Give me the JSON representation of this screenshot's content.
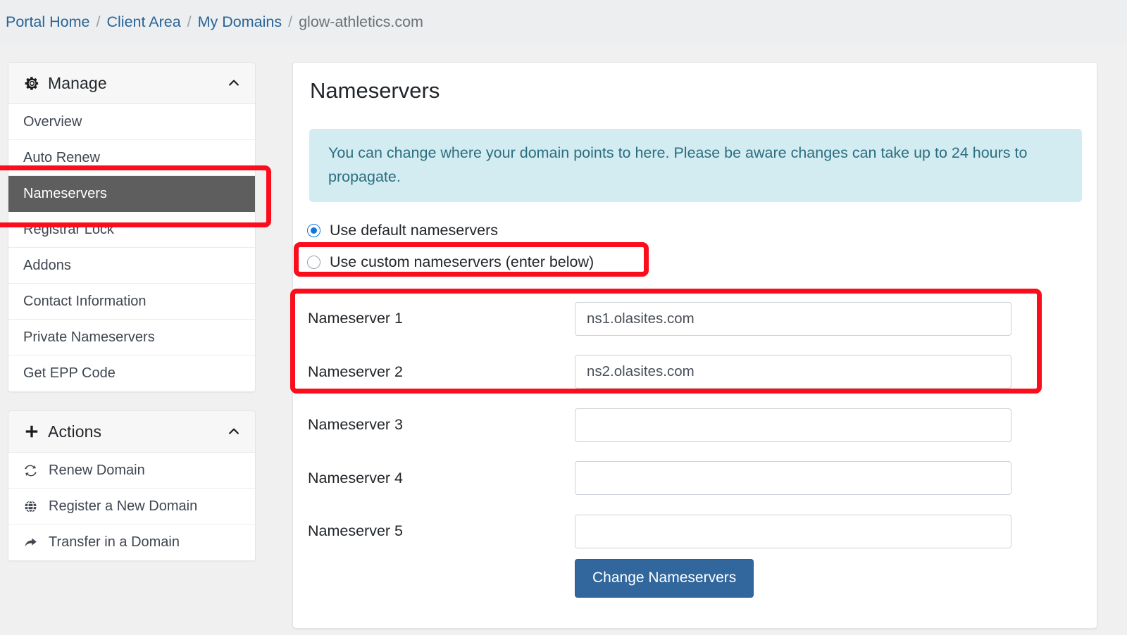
{
  "breadcrumb": {
    "items": [
      {
        "label": "Portal Home",
        "link": true
      },
      {
        "label": "Client Area",
        "link": true
      },
      {
        "label": "My Domains",
        "link": true
      },
      {
        "label": "glow-athletics.com",
        "link": false
      }
    ],
    "separator": "/"
  },
  "sidebar": {
    "manage": {
      "title": "Manage",
      "icon": "gear-icon",
      "caret": "chevron-up-icon",
      "items": [
        {
          "label": "Overview",
          "active": false
        },
        {
          "label": "Auto Renew",
          "active": false
        },
        {
          "label": "Nameservers",
          "active": true
        },
        {
          "label": "Registrar Lock",
          "active": false
        },
        {
          "label": "Addons",
          "active": false
        },
        {
          "label": "Contact Information",
          "active": false
        },
        {
          "label": "Private Nameservers",
          "active": false
        },
        {
          "label": "Get EPP Code",
          "active": false
        }
      ]
    },
    "actions": {
      "title": "Actions",
      "icon": "plus-icon",
      "caret": "chevron-up-icon",
      "items": [
        {
          "label": "Renew Domain",
          "icon": "refresh-icon"
        },
        {
          "label": "Register a New Domain",
          "icon": "globe-icon"
        },
        {
          "label": "Transfer in a Domain",
          "icon": "share-arrow-icon"
        }
      ]
    }
  },
  "main": {
    "title": "Nameservers",
    "alert": "You can change where your domain points to here. Please be aware changes can take up to 24 hours to propagate.",
    "nameserver_mode": {
      "options": [
        {
          "label": "Use default nameservers",
          "selected": true
        },
        {
          "label": "Use custom nameservers (enter below)",
          "selected": false
        }
      ]
    },
    "nameservers": [
      {
        "label": "Nameserver 1",
        "value": "ns1.olasites.com",
        "placeholder": ""
      },
      {
        "label": "Nameserver 2",
        "value": "ns2.olasites.com",
        "placeholder": ""
      },
      {
        "label": "Nameserver 3",
        "value": "",
        "placeholder": ""
      },
      {
        "label": "Nameserver 4",
        "value": "",
        "placeholder": ""
      },
      {
        "label": "Nameserver 5",
        "value": "",
        "placeholder": ""
      }
    ],
    "submit_label": "Change Nameservers"
  },
  "annotations": {
    "color": "#fc0d1b",
    "boxes": [
      {
        "name": "sidebar-nameservers-highlight"
      },
      {
        "name": "custom-nameservers-radio-highlight"
      },
      {
        "name": "nameserver-fields-highlight"
      }
    ]
  },
  "colors": {
    "page_background": "#f0f0f0",
    "breadcrumb_background": "#eceef0",
    "link": "#2a6496",
    "active_nav": "#5e5e5e",
    "alert_background": "#d3ecf1",
    "alert_text": "#2b6e80",
    "primary_button": "#31679d",
    "radio_accent": "#1177dd",
    "annotation": "#fc0d1b"
  }
}
